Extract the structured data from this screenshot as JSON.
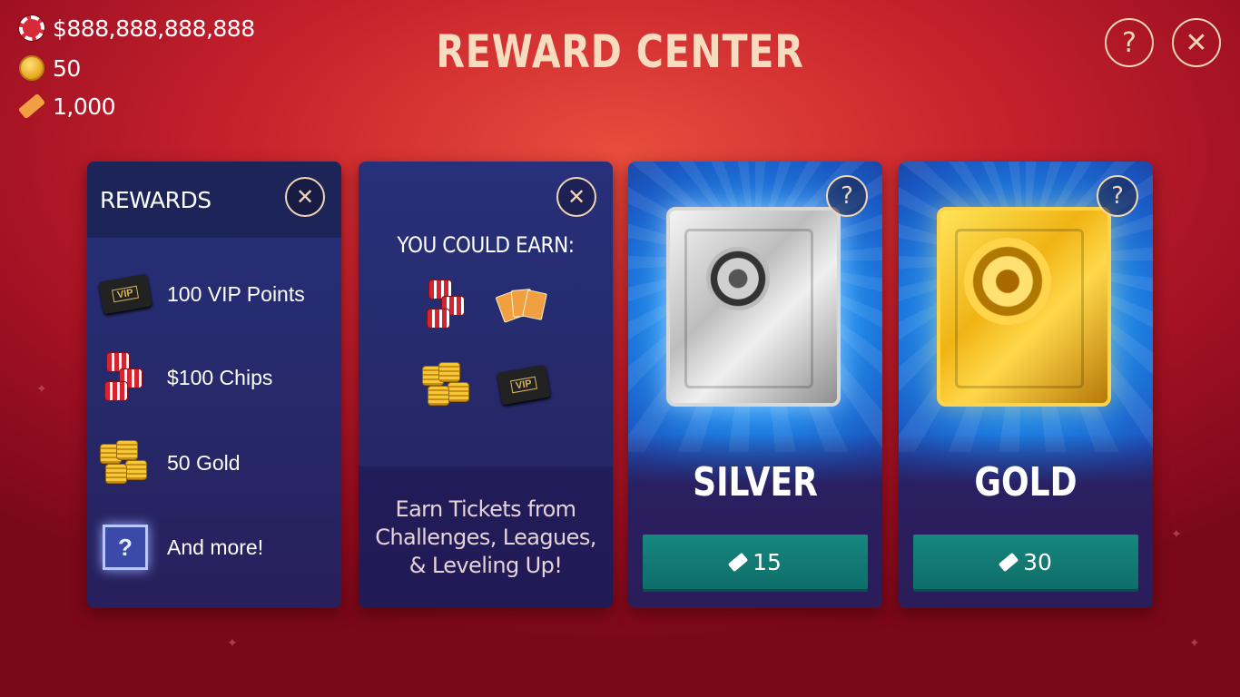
{
  "currencies": {
    "chips": "$888,888,888,888",
    "gold": "50",
    "tickets": "1,000"
  },
  "header": {
    "title": "REWARD CENTER",
    "help_symbol": "?",
    "close_symbol": "✕"
  },
  "rewards_panel": {
    "title": "REWARDS",
    "close_symbol": "✕",
    "items": [
      {
        "label": "100 VIP Points",
        "icon": "vip-card-icon"
      },
      {
        "label": "$100 Chips",
        "icon": "chip-stack-icon"
      },
      {
        "label": "50 Gold",
        "icon": "gold-stack-icon"
      },
      {
        "label": "And more!",
        "icon": "mystery-box-icon"
      }
    ],
    "mystery_symbol": "?",
    "vip_text": "VIP"
  },
  "earn_panel": {
    "title": "YOU COULD EARN:",
    "close_symbol": "✕",
    "icons": [
      "chip-stack-icon",
      "cards-icon",
      "gold-stack-icon",
      "vip-card-icon"
    ],
    "vip_text": "VIP",
    "footer": "Earn Tickets from Challenges, Leagues, & Leveling Up!"
  },
  "safes": [
    {
      "name": "SILVER",
      "cost": "15",
      "help_symbol": "?"
    },
    {
      "name": "GOLD",
      "cost": "30",
      "help_symbol": "?"
    }
  ],
  "colors": {
    "background": "#c8222d",
    "panel": "#262a6b",
    "button": "#16877e",
    "accent": "#f0d6b4"
  }
}
